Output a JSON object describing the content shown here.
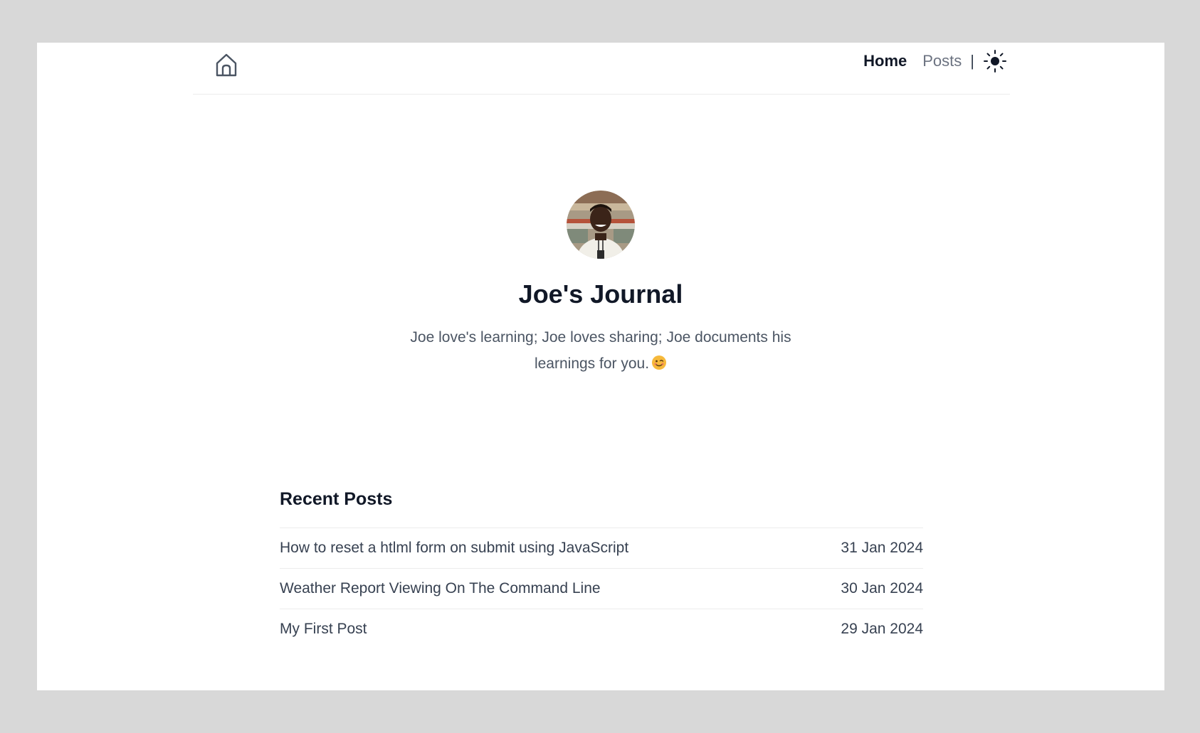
{
  "nav": {
    "home_icon": "home-icon",
    "links": [
      {
        "label": "Home",
        "active": true
      },
      {
        "label": "Posts",
        "active": false
      }
    ],
    "separator": "|",
    "theme_icon": "sun-icon"
  },
  "hero": {
    "avatar": "avatar",
    "title": "Joe's Journal",
    "tagline": "Joe love's learning; Joe loves sharing; Joe documents his learnings for you.",
    "emoji": "winking-face-icon"
  },
  "recent_posts": {
    "heading": "Recent Posts",
    "items": [
      {
        "title": "How to reset a htlml form on submit using JavaScript",
        "date": "31 Jan 2024"
      },
      {
        "title": "Weather Report Viewing On The Command Line",
        "date": "30 Jan 2024"
      },
      {
        "title": "My First Post",
        "date": "29 Jan 2024"
      }
    ]
  },
  "colors": {
    "background": "#d8d8d8",
    "page": "#ffffff",
    "heading": "#111827",
    "muted_text": "#6b7280",
    "body_text": "#374151",
    "divider": "#ececec"
  }
}
